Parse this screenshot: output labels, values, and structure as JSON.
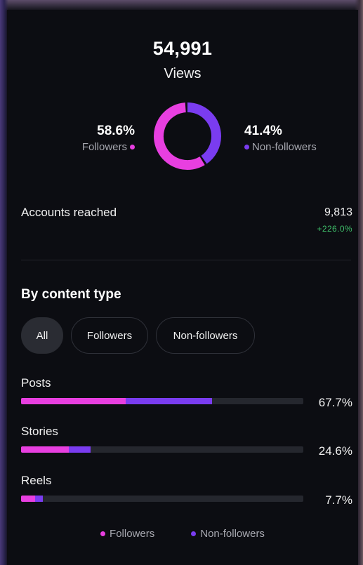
{
  "summary": {
    "total_views": "54,991",
    "views_label": "Views",
    "followers_pct": "58.6%",
    "followers_label": "Followers",
    "followers_share": 58.6,
    "nonfollowers_pct": "41.4%",
    "nonfollowers_label": "Non-followers",
    "nonfollowers_share": 41.4
  },
  "reach": {
    "label": "Accounts reached",
    "value": "9,813",
    "delta": "+226.0%"
  },
  "content_type": {
    "title": "By content type",
    "filters": [
      {
        "label": "All",
        "active": true
      },
      {
        "label": "Followers",
        "active": false
      },
      {
        "label": "Non-followers",
        "active": false
      }
    ],
    "rows": [
      {
        "label": "Posts",
        "pct": "67.7%",
        "total": 67.7,
        "followers": 37.0
      },
      {
        "label": "Stories",
        "pct": "24.6%",
        "total": 24.6,
        "followers": 17.0
      },
      {
        "label": "Reels",
        "pct": "7.7%",
        "total": 7.7,
        "followers": 5.0
      }
    ]
  },
  "legend": {
    "followers": "Followers",
    "nonfollowers": "Non-followers"
  },
  "colors": {
    "followers": "#e83fe0",
    "nonfollowers": "#7a3cf0",
    "track": "#25272e",
    "positive": "#3fbf6a"
  }
}
